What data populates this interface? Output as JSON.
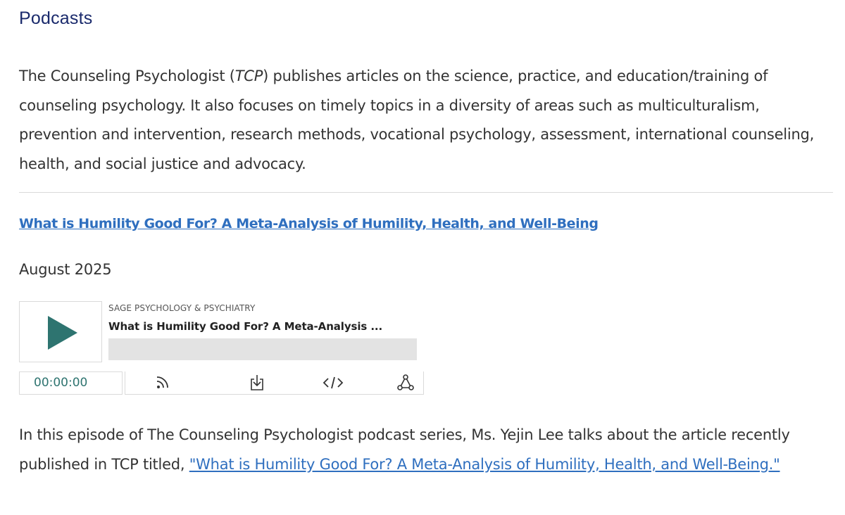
{
  "section": {
    "heading": "Podcasts"
  },
  "intro": {
    "before_italic": "The Counseling Psychologist (",
    "italic": "TCP",
    "after_italic": ") publishes articles on the science, practice, and education/training of counseling psychology. It also focuses on timely topics in a diversity of areas such as multiculturalism, prevention and intervention, research methods, vocational psychology, assessment, international counseling, health, and social justice and advocacy."
  },
  "article": {
    "link_text": "What is Humility Good For? A Meta-Analysis of Humility, Health, and Well-Being",
    "date": "August 2025"
  },
  "player": {
    "publisher": "SAGE PSYCHOLOGY & PSYCHIATRY",
    "episode_title": "What is Humility Good For? A Meta-Analysis ...",
    "current_time": "00:00:00",
    "progress": 0,
    "accent_color": "#2e7470",
    "controls": [
      "rss-icon",
      "download-icon",
      "embed-code-icon",
      "share-icon"
    ]
  },
  "description": {
    "text": "In this episode of The Counseling Psychologist podcast series, Ms. Yejin Lee talks about the article recently published in TCP titled, ",
    "link_text": "\"What is Humility Good For? A Meta-Analysis of Humility, Health, and Well-Being.\""
  },
  "colors": {
    "heading": "#1a2a6c",
    "link": "#2f6fbf",
    "body_text": "#333333",
    "divider": "#d9d9d9"
  }
}
